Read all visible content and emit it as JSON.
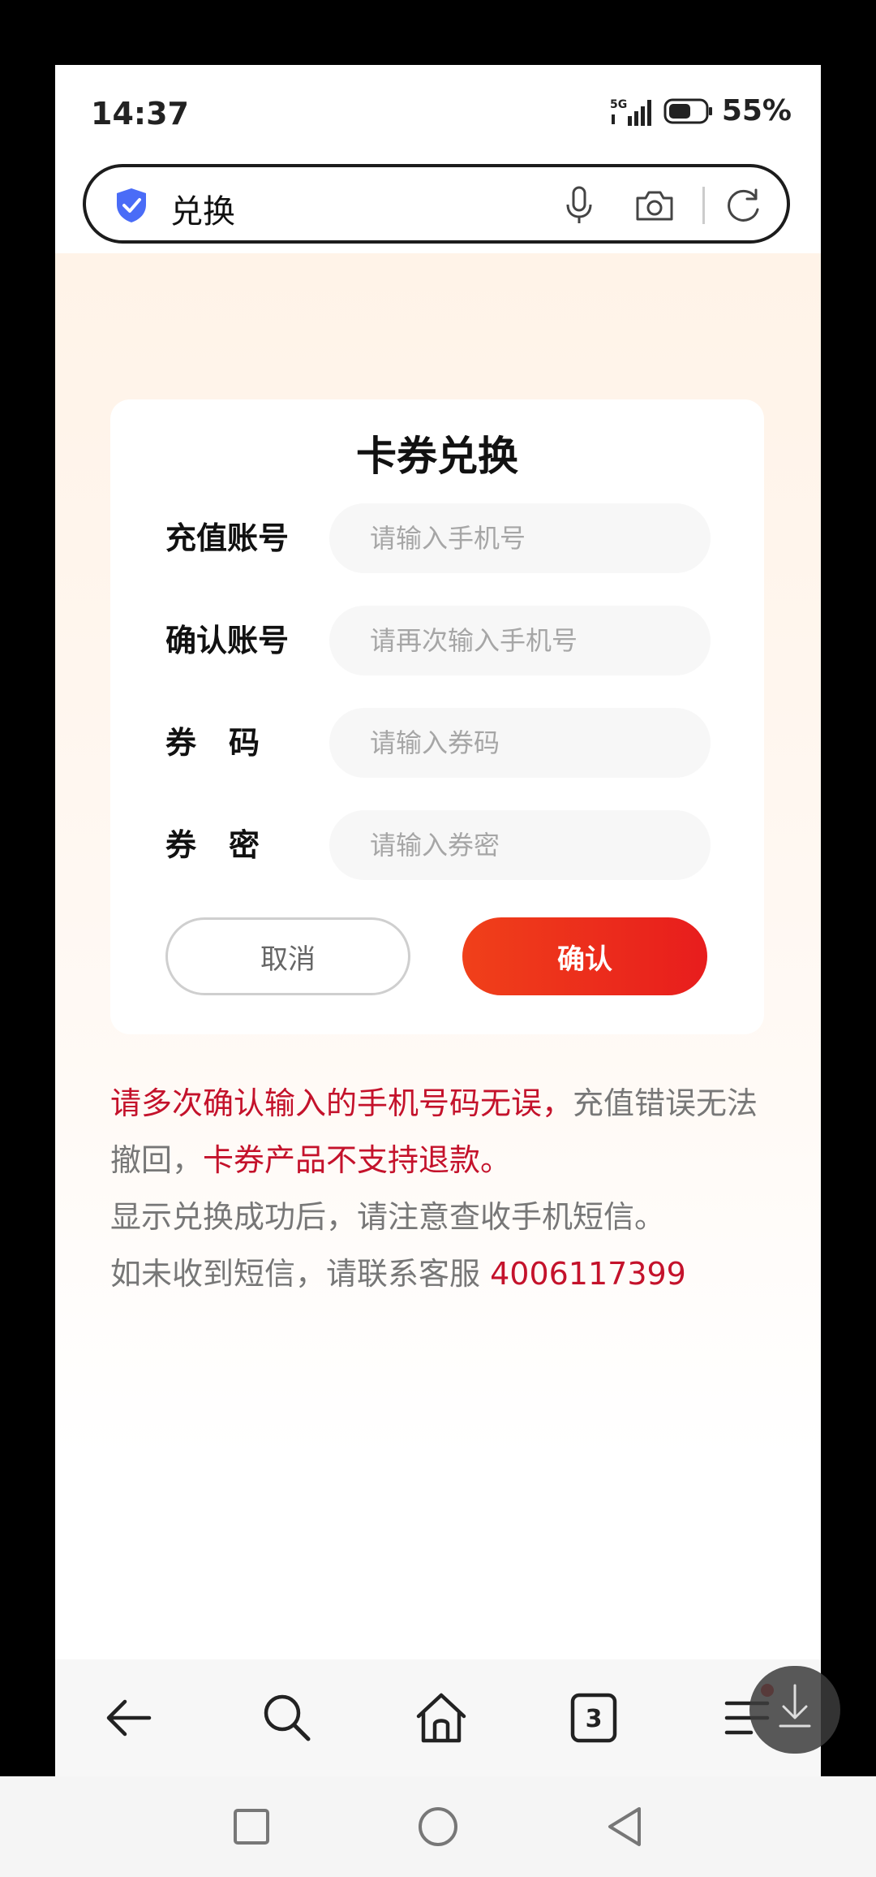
{
  "status_bar": {
    "time": "14:37",
    "network": "5G",
    "battery": "55%"
  },
  "address_bar": {
    "text": "兑换"
  },
  "card": {
    "title": "卡券兑换",
    "fields": [
      {
        "label": "充值账号",
        "placeholder": "请输入手机号"
      },
      {
        "label": "确认账号",
        "placeholder": "请再次输入手机号"
      },
      {
        "label": "券码",
        "placeholder": "请输入券码"
      },
      {
        "label": "券密",
        "placeholder": "请输入券密"
      }
    ],
    "cancel_label": "取消",
    "confirm_label": "确认"
  },
  "notice": {
    "l1_red": "请多次确认输入的手机号码无误，",
    "l1_gray": "充值错误无法撤回，",
    "l1_red2": "卡券产品不支持退款。",
    "l2": "显示兑换成功后，请注意查收手机短信。",
    "l3": "如未收到短信，请联系客服 ",
    "phone": "4006117399"
  },
  "toolbar": {
    "tabs_count": "3"
  },
  "colors": {
    "accent_red": "#e81d1d",
    "notice_red": "#c4122b"
  }
}
